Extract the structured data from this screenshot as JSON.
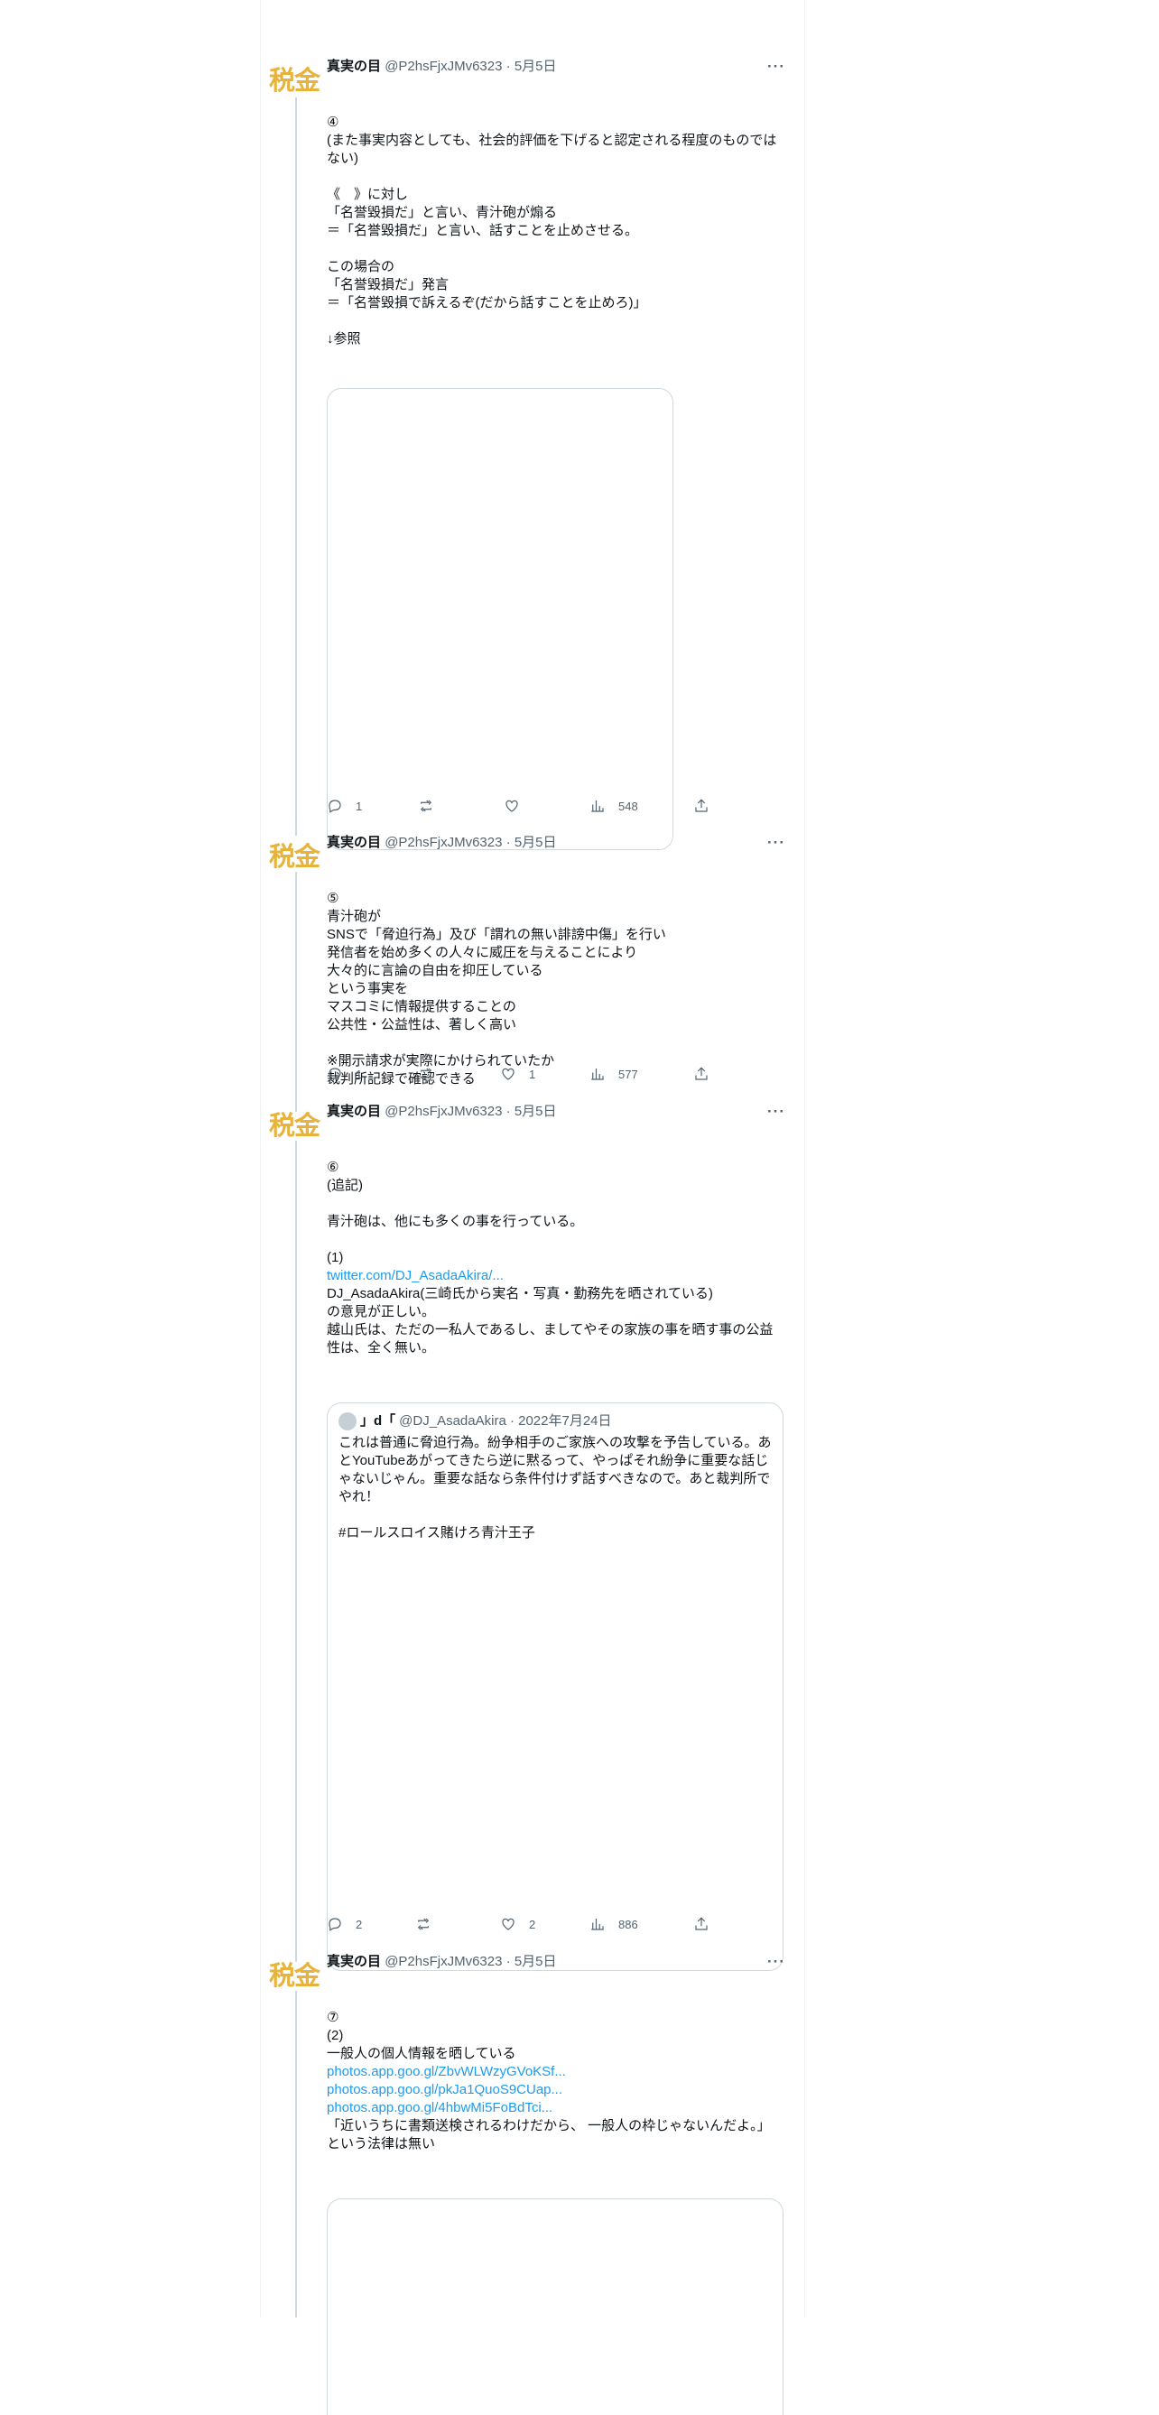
{
  "tweets": [
    {
      "avatar_text": "税金",
      "name": "真実の目",
      "handle": "@P2hsFjxJMv6323",
      "date": "5月5日",
      "more": "···",
      "lines": [
        "④",
        "(また事実内容としても、社会的評価を下げると認定される程度のものではない)",
        "",
        "《　》に対し",
        "「名誉毀損だ」と言い、青汁砲が煽る",
        "＝「名誉毀損だ」と言い、話すことを止めさせる。",
        "",
        "この場合の",
        "「名誉毀損だ」発言",
        "＝「名誉毀損で訴えるぞ(だから話すことを止めろ)」",
        "",
        "↓参照"
      ],
      "stats": {
        "reply": "1",
        "retweet": "",
        "like": "",
        "views": "548"
      }
    },
    {
      "avatar_text": "税金",
      "name": "真実の目",
      "handle": "@P2hsFjxJMv6323",
      "date": "5月5日",
      "more": "···",
      "lines": [
        "⑤",
        "青汁砲が",
        "SNSで「脅迫行為」及び「謂れの無い誹謗中傷」を行い",
        "発信者を始め多くの人々に威圧を与えることにより",
        "大々的に言論の自由を抑圧している",
        "という事実を",
        "マスコミに情報提供することの",
        "公共性・公益性は、著しく高い",
        "",
        "※開示請求が実際にかけられていたか",
        "裁判所記録で確認できる"
      ],
      "stats": {
        "reply": "1",
        "retweet": "",
        "like": "1",
        "views": "577"
      }
    },
    {
      "avatar_text": "税金",
      "name": "真実の目",
      "handle": "@P2hsFjxJMv6323",
      "date": "5月5日",
      "more": "···",
      "lines_before_link": [
        "⑥",
        "(追記)",
        "",
        "青汁砲は、他にも多くの事を行っている。",
        "",
        "(1)"
      ],
      "link": "twitter.com/DJ_AsadaAkira/...",
      "lines_after_link": [
        "DJ_AsadaAkira(三崎氏から実名・写真・勤務先を晒されている)",
        "の意見が正しい。",
        "越山氏は、ただの一私人であるし、ましてやその家族の事を晒す事の公益性は、全く無い。"
      ],
      "quote": {
        "name": "」d「",
        "handle": "@DJ_AsadaAkira",
        "date": "2022年7月24日",
        "text": "これは普通に脅迫行為。紛争相手のご家族への攻撃を予告している。あとYouTubeあがってきたら逆に黙るって、やっぱそれ紛争に重要な話じゃないじゃん。重要な話なら条件付けず話すべきなので。あと裁判所でやれ！\n\n#ロールスロイス賭けろ青汁王子"
      },
      "stats": {
        "reply": "2",
        "retweet": "",
        "like": "2",
        "views": "886"
      }
    },
    {
      "avatar_text": "税金",
      "name": "真実の目",
      "handle": "@P2hsFjxJMv6323",
      "date": "5月5日",
      "more": "···",
      "lines_before_links": [
        "⑦",
        "(2)",
        "一般人の個人情報を晒している"
      ],
      "links": [
        "photos.app.goo.gl/ZbvWLWzyGVoKSf...",
        "photos.app.goo.gl/pkJa1QuoS9CUap...",
        "photos.app.goo.gl/4hbwMi5FoBdTci..."
      ],
      "lines_after_links": [
        "「近いうちに書類送検されるわけだから、 一般人の枠じゃないんだよ。」",
        "という法律は無い"
      ]
    }
  ]
}
